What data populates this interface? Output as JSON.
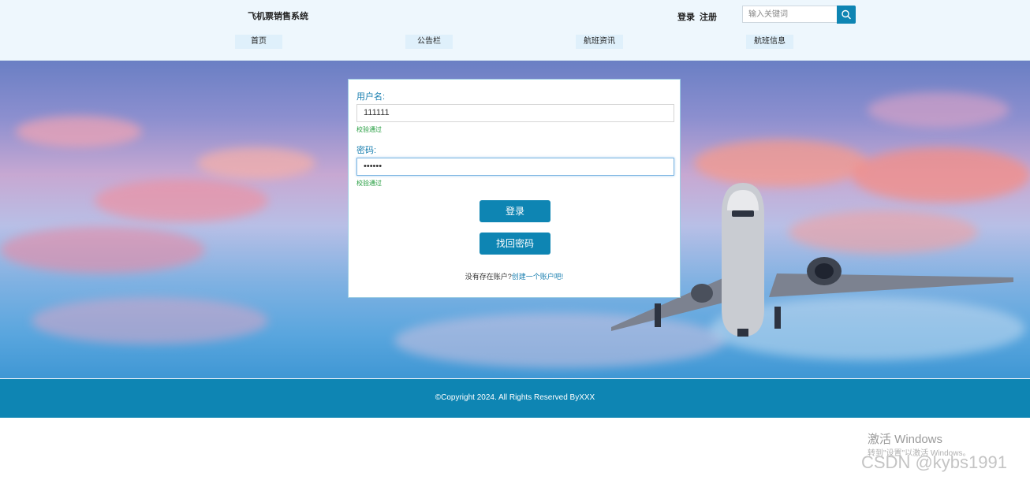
{
  "header": {
    "site_title": "飞机票销售系统",
    "login_link": "登录",
    "register_link": "注册",
    "search_placeholder": "输入关键词",
    "search_icon": "search-icon"
  },
  "nav": [
    {
      "label": "首页"
    },
    {
      "label": "公告栏"
    },
    {
      "label": "航班资讯"
    },
    {
      "label": "航班信息"
    }
  ],
  "login_form": {
    "username_label": "用户名:",
    "username_value": "111111",
    "username_status": "校验通过",
    "password_label": "密码:",
    "password_value": "••••••",
    "password_status": "校验通过",
    "login_button": "登录",
    "recover_button": "找回密码",
    "register_prompt": "没有存在账户?",
    "register_link": "创建一个账户吧!"
  },
  "footer": {
    "copyright": "©Copyright 2024. All Rights Reserved ByXXX"
  },
  "watermarks": {
    "windows_title": "激活 Windows",
    "windows_sub": "转到\"设置\"以激活 Windows。",
    "csdn": "CSDN @kybs1991"
  },
  "colors": {
    "accent": "#0e85b3",
    "header_bg": "#eef7fd",
    "valid_text": "#1e9a3a"
  }
}
